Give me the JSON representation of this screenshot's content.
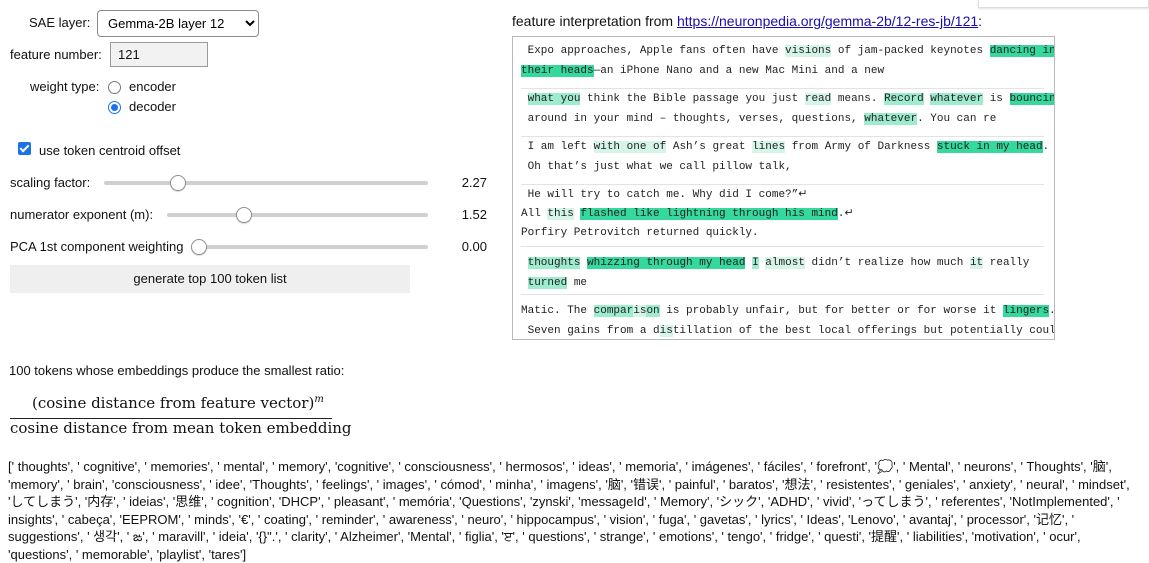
{
  "sae_layer": {
    "label": "SAE layer:",
    "selected": "Gemma-2B layer 12"
  },
  "feature_number": {
    "label": "feature number:",
    "value": "121"
  },
  "weight_type": {
    "label": "weight type:",
    "options": [
      "encoder",
      "decoder"
    ],
    "selected": "decoder"
  },
  "centroid_offset": {
    "label": "use token centroid offset",
    "checked": true
  },
  "sliders": [
    {
      "label": "scaling factor:",
      "value": "2.27"
    },
    {
      "label": "numerator exponent (m):",
      "value": "1.52"
    },
    {
      "label": "PCA 1st component weighting",
      "value": "0.00"
    }
  ],
  "generate_button": "generate top 100 token list",
  "interpretation": {
    "prefix": "feature interpretation from ",
    "link": "https://neuronpedia.org/gemma-2b/12-res-jb/121",
    "suffix": ":",
    "examples": [
      [
        " Expo approaches, Apple fans often have visions of jam-packed keynotes dancing in",
        "their heads—an iPhone Nano and a new Mac Mini and a new"
      ],
      [
        " what you think the Bible passage you just read means. Record whatever is bouncing",
        " around in your mind – thoughts, verses, questions, whatever. You can re"
      ],
      [
        " I am left with one of Ash’s great lines from Army of Darkness stuck in my head.",
        " Oh that’s just what we call pillow talk,"
      ],
      [
        " He will try to catch me. Why did I come?”↵",
        "All this flashed like lightning through his mind.↵",
        "Porfiry Petrovitch returned quickly."
      ],
      [
        " thoughts whizzing through my head I almost didn’t realize how much it really",
        " turned me"
      ],
      [
        "Matic. The comparison is probably unfair, but for better or for worse it lingers.",
        " Seven gains from a distillation of the best local offerings but potentially could"
      ]
    ]
  },
  "ratio_heading": "100 tokens whose embeddings produce the smallest ratio:",
  "formula": {
    "numerator": "(cosine distance from feature vector)",
    "exponent": "m",
    "denominator": "cosine distance from mean token embedding"
  },
  "token_list": "[' thoughts', ' cognitive', ' memories', ' mental', ' memory', 'cognitive', ' consciousness', ' hermosos', ' ideas', ' memoria', ' imágenes', ' fáciles', ' forefront', '💭', ' Mental', ' neurons', ' Thoughts', '脑', 'memory', ' brain', 'consciousness', ' idee', 'Thoughts', ' feelings', ' images', ' cómod', ' minha', ' imagens', '脑', '错误', ' painful', ' baratos', '想法', ' resistentes', ' geniales', ' anxiety', ' neural', ' mindset', 'してしまう', '内存', ' ideias', '思维', ' cognition', 'DHCP', ' pleasant', ' memória', 'Questions', 'zynski', 'messageId', ' Memory', 'シック', 'ADHD', ' vivid', 'ってしまう', ' referentes', 'NotImplemented', ' insights', ' cabeça', 'EEPROM', ' minds', '€', ' coating', ' reminder', ' awareness', ' neuro', ' hippocampus', ' vision', ' fuga', ' gavetas', ' lyrics', ' Ideas', 'Lenovo', ' avantaj', ' processor', '记忆', ' suggestions', ' 생각', ' ఙ', ' maravill', ' ideia', '{}\".', ' clarity', ' Alzheimer', 'Mental', ' figlia', 'ੲ', ' questions', ' strange', ' emotions', ' tengo', ' fridge', ' questi', '提醒', ' liabilities', 'motivation', ' ocur', 'questions', ' memorable', 'playlist', 'tares']"
}
